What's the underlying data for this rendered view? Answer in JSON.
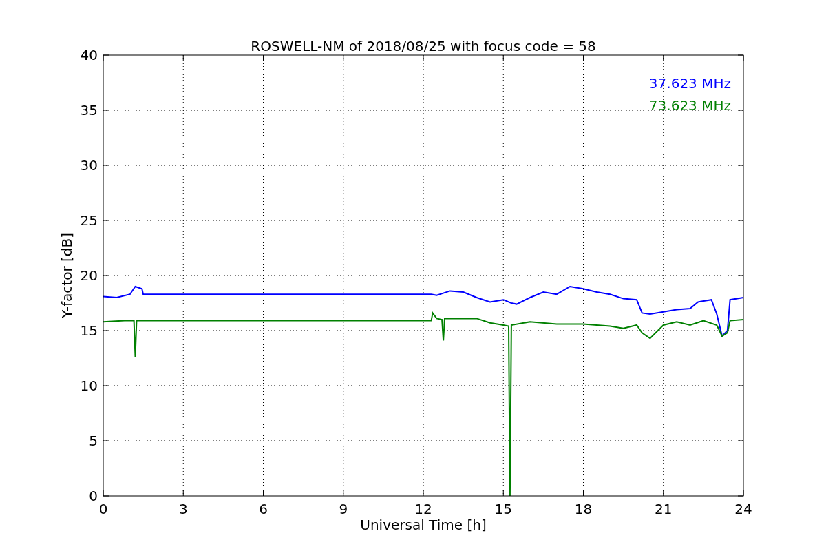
{
  "figure": {
    "chart_data": {
      "type": "line",
      "title": "ROSWELL-NM of 2018/08/25 with focus code = 58",
      "xlabel": "Universal Time [h]",
      "ylabel": "Y-factor [dB]",
      "xlim": [
        0,
        24
      ],
      "ylim": [
        0,
        40
      ],
      "xticks": [
        0,
        3,
        6,
        9,
        12,
        15,
        18,
        21,
        24
      ],
      "yticks": [
        0,
        5,
        10,
        15,
        20,
        25,
        30,
        35,
        40
      ],
      "grid": true,
      "series": [
        {
          "name": "37.623 MHz",
          "color": "#0000ff",
          "x": [
            0,
            0.5,
            1.0,
            1.2,
            1.45,
            1.5,
            12.3,
            12.5,
            13,
            13.5,
            14,
            14.5,
            15,
            15.3,
            15.5,
            16,
            16.5,
            17,
            17.5,
            18,
            18.5,
            19,
            19.5,
            20,
            20.2,
            20.5,
            21,
            21.5,
            22,
            22.3,
            22.8,
            23,
            23.2,
            23.4,
            23.5,
            24
          ],
          "values": [
            18.1,
            18.0,
            18.3,
            19.0,
            18.8,
            18.3,
            18.3,
            18.2,
            18.6,
            18.5,
            18.0,
            17.6,
            17.8,
            17.5,
            17.4,
            18.0,
            18.5,
            18.3,
            19.0,
            18.8,
            18.5,
            18.3,
            17.9,
            17.8,
            16.6,
            16.5,
            16.7,
            16.9,
            17.0,
            17.6,
            17.8,
            16.5,
            14.5,
            15.0,
            17.8,
            18.0
          ]
        },
        {
          "name": "73.623 MHz",
          "color": "#008000",
          "x": [
            0,
            0.8,
            1.15,
            1.2,
            1.25,
            1.5,
            12.3,
            12.35,
            12.5,
            12.7,
            12.75,
            12.8,
            14,
            14.5,
            15,
            15.2,
            15.25,
            15.3,
            16,
            17,
            18,
            19,
            19.5,
            20,
            20.2,
            20.5,
            21,
            21.5,
            22,
            22.5,
            23,
            23.2,
            23.4,
            23.5,
            24
          ],
          "values": [
            15.8,
            15.9,
            15.9,
            12.6,
            15.9,
            15.9,
            15.9,
            16.6,
            16.1,
            16.0,
            14.1,
            16.1,
            16.1,
            15.7,
            15.5,
            15.4,
            0,
            15.5,
            15.8,
            15.6,
            15.6,
            15.4,
            15.2,
            15.5,
            14.8,
            14.3,
            15.5,
            15.8,
            15.5,
            15.9,
            15.5,
            14.5,
            14.8,
            15.9,
            16.0
          ]
        }
      ]
    }
  }
}
